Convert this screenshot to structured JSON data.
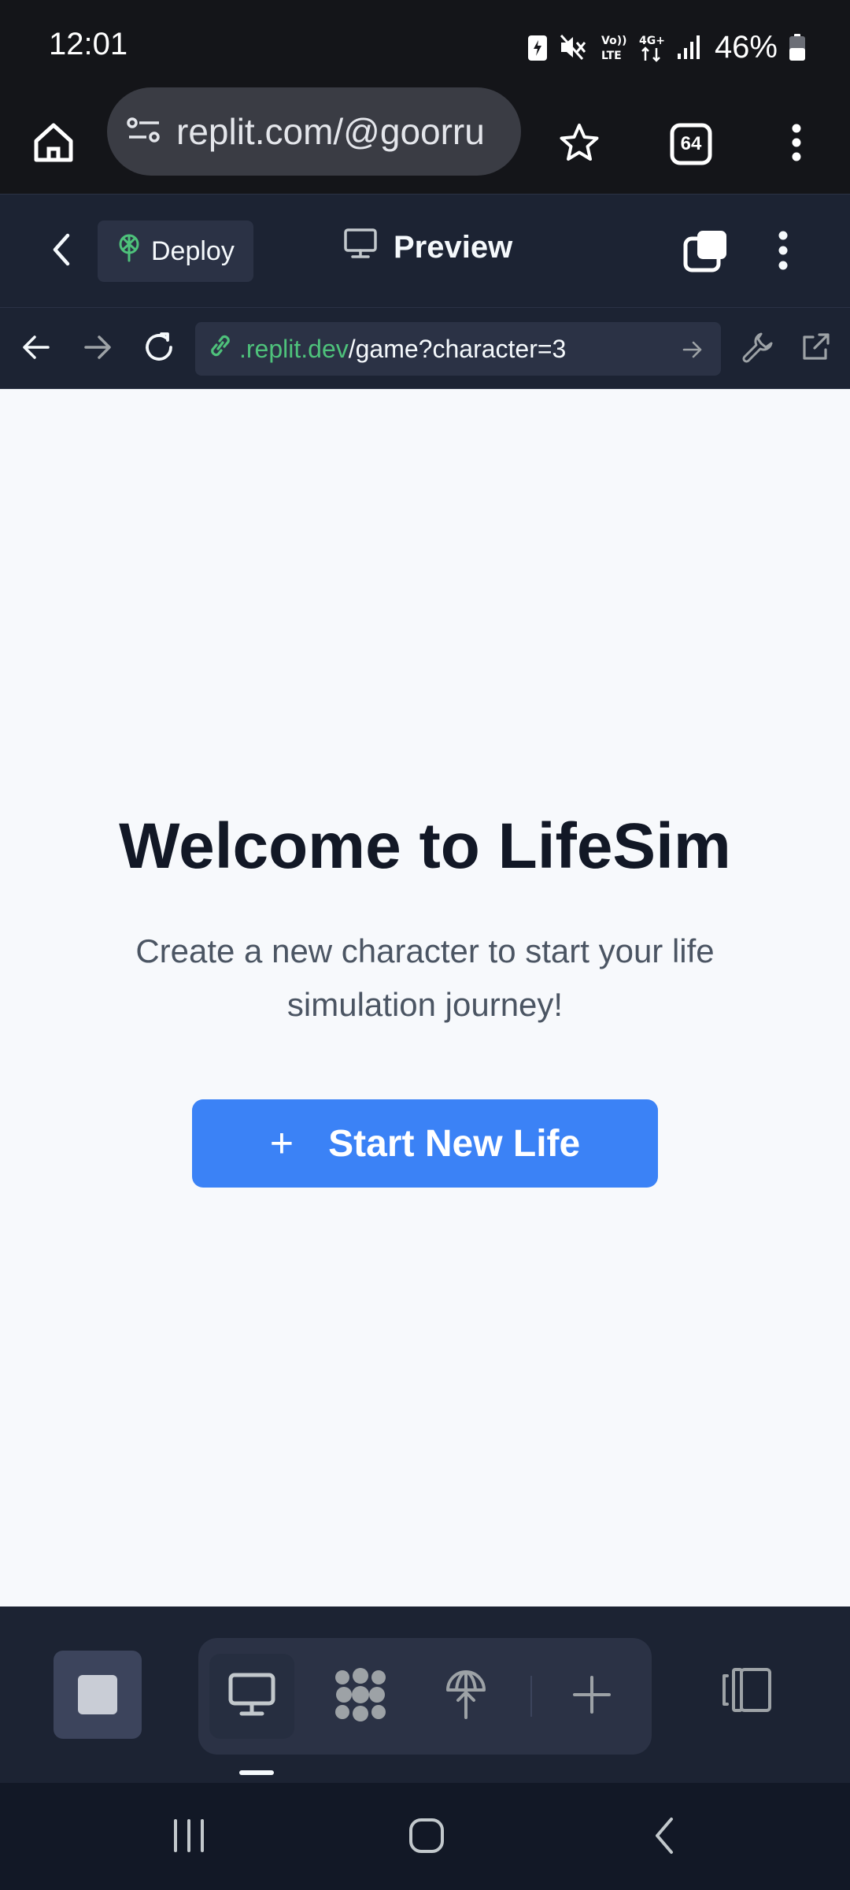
{
  "status_bar": {
    "time": "12:01",
    "battery": "46%",
    "icons": [
      "battery-saver-icon",
      "mute-icon",
      "volte-icon",
      "4g-icon",
      "signal-icon",
      "battery-icon"
    ],
    "volte_label_top": "Vo))",
    "volte_label_bottom": "LTE",
    "network_label": "4G+"
  },
  "browser": {
    "url": "replit.com/@goorru",
    "tab_count": "64",
    "icons": [
      "home-icon",
      "site-settings-icon",
      "star-icon",
      "tabs-icon",
      "more-vert-icon"
    ]
  },
  "replit_header": {
    "deploy_label": "Deploy",
    "preview_label": "Preview",
    "icons": [
      "back-chevron-icon",
      "deploy-icon",
      "monitor-icon",
      "copy-icon",
      "more-vert-icon"
    ]
  },
  "webview": {
    "url_domain": ".replit.dev",
    "url_path": "/game?character=3",
    "icons": [
      "back-arrow-icon",
      "forward-arrow-icon",
      "reload-icon",
      "link-icon",
      "go-arrow-icon",
      "devtools-wrench-icon",
      "open-external-icon"
    ]
  },
  "page": {
    "title": "Welcome to LifeSim",
    "subtitle": "Create a new character to start your life simulation journey!",
    "start_button_icon": "+",
    "start_button_label": "Start New Life"
  },
  "toolbar": {
    "icons": [
      "stop-icon",
      "webview-monitor-icon",
      "agent-icon",
      "deployments-icon",
      "add-tab-icon",
      "panel-toggle-icon"
    ],
    "active_tab": "webview-monitor-icon"
  },
  "nav_bar": {
    "icons": [
      "recents-icon",
      "home-circle-icon",
      "nav-back-icon"
    ]
  },
  "colors": {
    "primary_button": "#3b82f6",
    "replit_dark": "#1c2333",
    "url_green": "#4ec27b",
    "title_text": "#121826"
  }
}
